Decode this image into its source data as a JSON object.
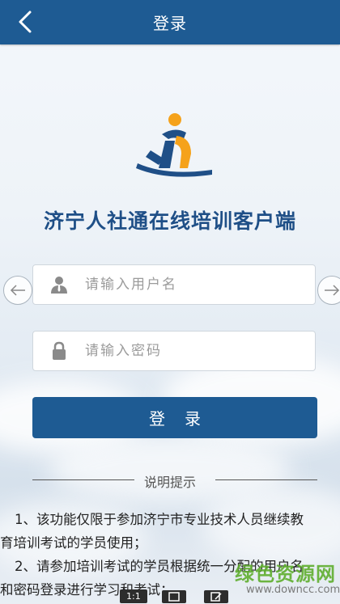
{
  "header": {
    "title": "登录"
  },
  "app": {
    "name": "济宁人社通在线培训客户端"
  },
  "form": {
    "username_placeholder": "请输入用户名",
    "password_placeholder": "请输入密码",
    "login_label": "登录"
  },
  "notes": {
    "divider_label": "说明提示",
    "lines": [
      "1、该功能仅限于参加济宁市专业技术人员继续教",
      "育培训考试的学员使用；",
      "2、请参加培训考试的学员根据统一分配的用户名",
      "和密码登录进行学习和考试；"
    ]
  },
  "watermark": {
    "cn": "绿色资源网",
    "url": "www.downcc.com"
  },
  "toolbar": {
    "ratio_label": "1:1"
  },
  "colors": {
    "primary": "#1e5b93",
    "logo_orange": "#f5a21b",
    "logo_blue": "#1f4f87"
  }
}
